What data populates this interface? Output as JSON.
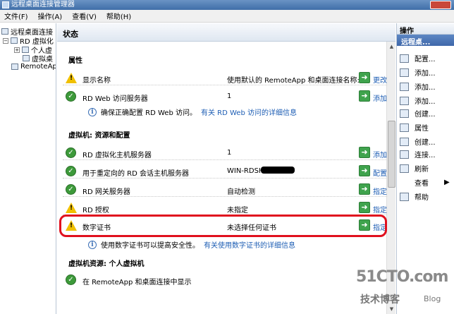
{
  "window": {
    "title": "远程桌面连接管理器"
  },
  "menu": [
    "文件(F)",
    "操作(A)",
    "查看(V)",
    "帮助(H)"
  ],
  "tree": {
    "root": "远程桌面连接",
    "rd": "RD 虚拟化",
    "personal": "个人虚",
    "vm": "虚拟桌",
    "remoteapp": "RemoteApp"
  },
  "main": {
    "header": "状态",
    "sections": {
      "props": "属性",
      "vm_resources": "虚拟机: 资源和配置",
      "personal_vm": "虚拟机资源: 个人虚拟机"
    },
    "rows": {
      "display_name": {
        "label": "显示名称",
        "value": "使用默认的 RemoteApp 和桌面连接名称:",
        "action": "更改"
      },
      "rdweb": {
        "label": "RD Web 访问服务器",
        "value": "1",
        "action": "添加"
      },
      "rdweb_info": {
        "text": "确保正确配置 RD Web 访问。",
        "link": "有关 RD Web 访问的详细信息"
      },
      "rdvh": {
        "label": "RD 虚拟化主机服务器",
        "value": "1",
        "action": "添加"
      },
      "redirect": {
        "label": "用于重定向的 RD 会话主机服务器",
        "value": "WIN-RDSH.",
        "action": "配置"
      },
      "gateway": {
        "label": "RD 网关服务器",
        "value": "自动检测",
        "action": "指定"
      },
      "licensing": {
        "label": "RD 授权",
        "value": "未指定",
        "action": "指定"
      },
      "cert": {
        "label": "数字证书",
        "value": "未选择任何证书",
        "action": "指定"
      },
      "cert_info": {
        "text": "使用数字证书可以提高安全性。",
        "link": "有关使用数字证书的详细信息"
      },
      "show_remoteapp": {
        "label": "在 RemoteApp 和桌面连接中显示"
      }
    }
  },
  "actions": {
    "title": "操作",
    "subtitle": "远程桌...",
    "items": [
      "配置...",
      "添加...",
      "添加...",
      "添加...",
      "创建...",
      "属性",
      "创建...",
      "连接...",
      "刷新",
      "查看",
      "帮助"
    ]
  },
  "watermark": {
    "main": "51CTO.com",
    "sub": "技术博客",
    "blog": "Blog"
  }
}
